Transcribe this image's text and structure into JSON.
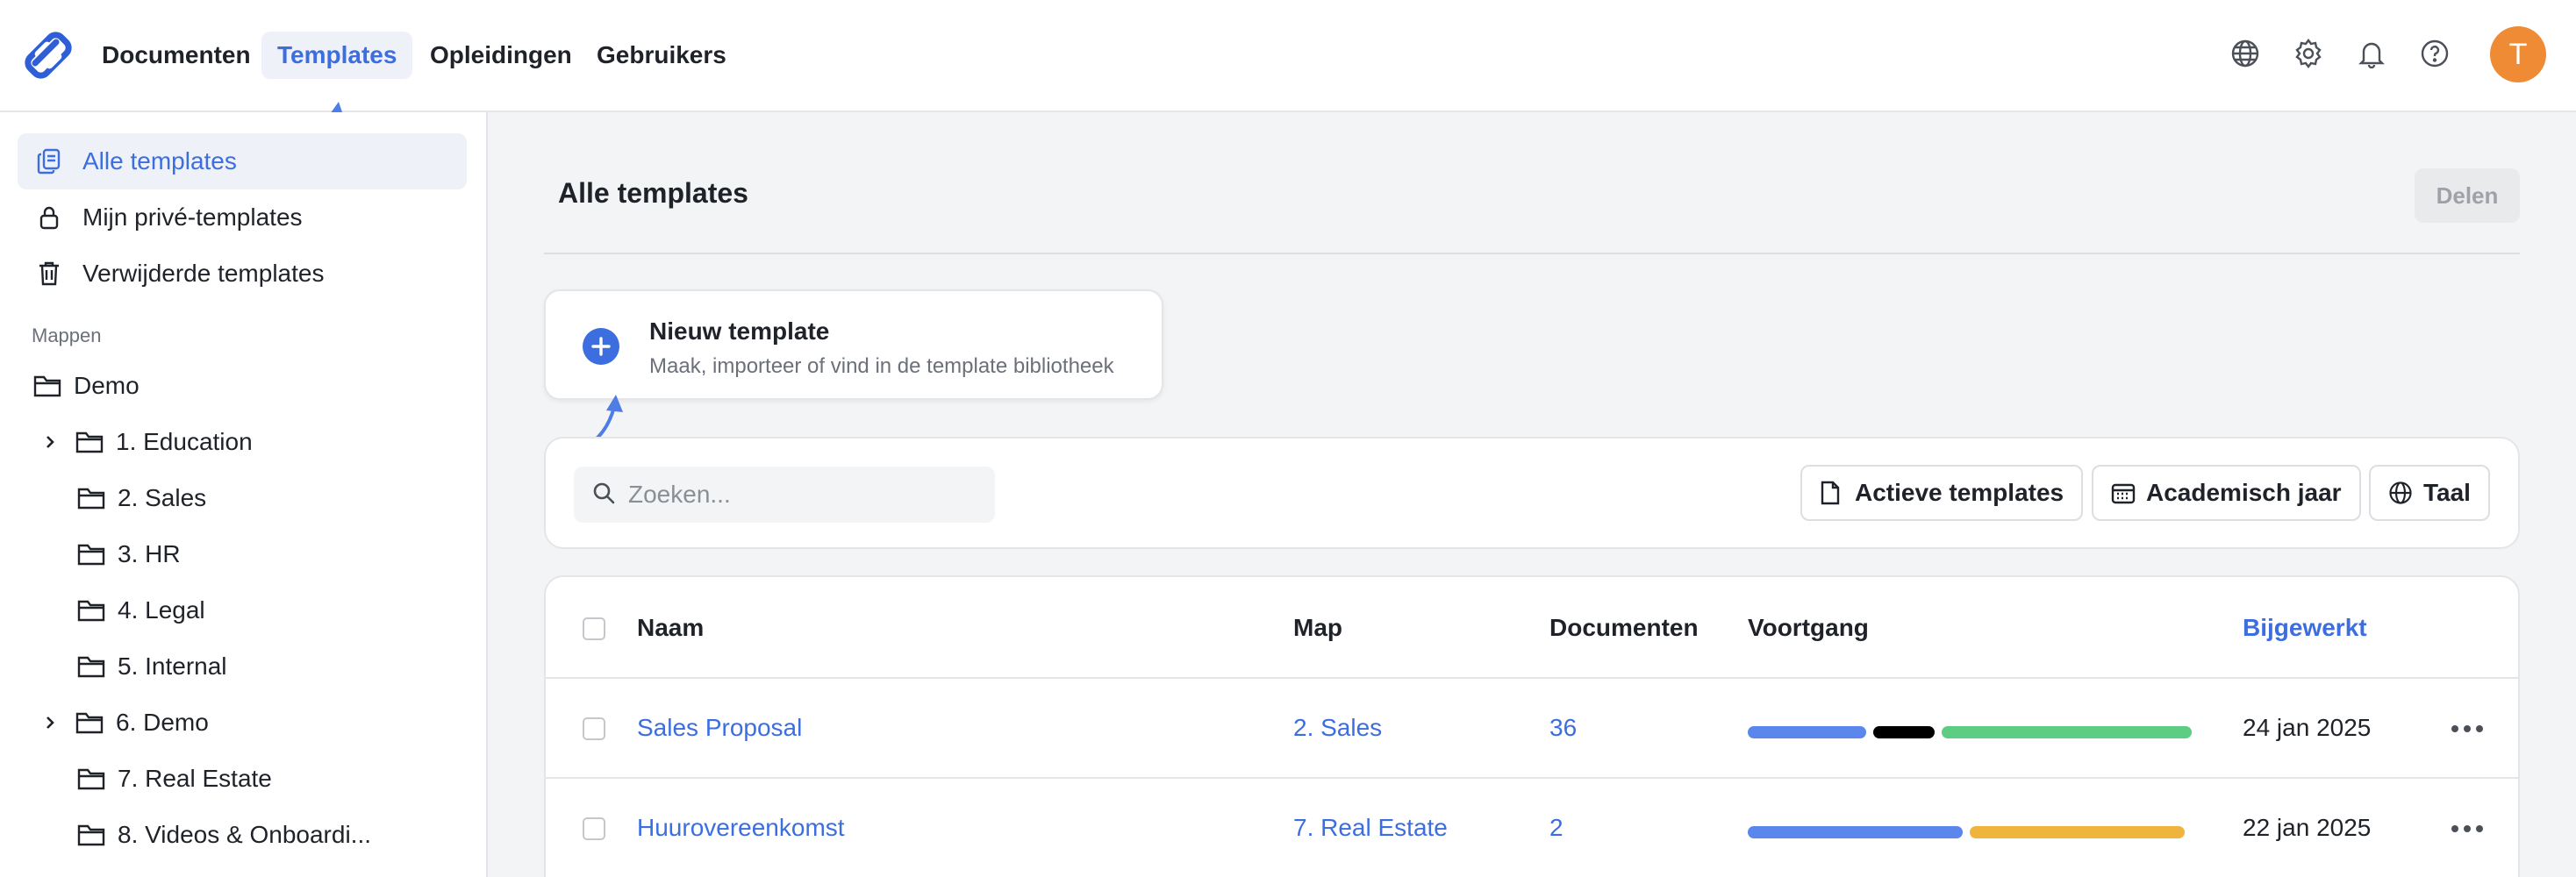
{
  "nav": {
    "items": [
      "Documenten",
      "Templates",
      "Opleidingen",
      "Gebruikers"
    ],
    "active": "Templates",
    "avatar_initial": "T"
  },
  "sidebar": {
    "items": [
      {
        "label": "Alle templates",
        "icon": "copy-icon",
        "active": true
      },
      {
        "label": "Mijn privé-templates",
        "icon": "lock-icon",
        "active": false
      },
      {
        "label": "Verwijderde templates",
        "icon": "trash-icon",
        "active": false
      }
    ],
    "section_label": "Mappen",
    "folders": [
      {
        "label": "Demo",
        "level": 0,
        "expandable": false
      },
      {
        "label": "1. Education",
        "level": 1,
        "expandable": true
      },
      {
        "label": "2. Sales",
        "level": 1,
        "expandable": false
      },
      {
        "label": "3. HR",
        "level": 1,
        "expandable": false
      },
      {
        "label": "4. Legal",
        "level": 1,
        "expandable": false
      },
      {
        "label": "5. Internal",
        "level": 1,
        "expandable": false
      },
      {
        "label": "6. Demo",
        "level": 1,
        "expandable": true
      },
      {
        "label": "7. Real Estate",
        "level": 1,
        "expandable": false
      },
      {
        "label": "8. Videos & Onboardi...",
        "level": 1,
        "expandable": false
      }
    ]
  },
  "main": {
    "title": "Alle templates",
    "share_label": "Delen",
    "new_template": {
      "title": "Nieuw template",
      "subtitle": "Maak, importeer of vind in de template bibliotheek"
    },
    "search_placeholder": "Zoeken...",
    "filters": [
      "Actieve templates",
      "Academisch jaar",
      "Taal"
    ]
  },
  "table": {
    "columns": [
      "Naam",
      "Map",
      "Documenten",
      "Voortgang",
      "Bijgewerkt"
    ],
    "sorted_column": "Bijgewerkt",
    "rows": [
      {
        "name": "Sales Proposal",
        "folder": "2. Sales",
        "documents": "36",
        "updated": "24 jan 2025",
        "progress": [
          {
            "share": 0.27,
            "color": "#5b86ec"
          },
          {
            "share": 0.14,
            "color": "#000000"
          },
          {
            "share": 0.57,
            "color": "#5ccd82"
          }
        ]
      },
      {
        "name": "Huurovereenkomst",
        "folder": "7. Real Estate",
        "documents": "2",
        "updated": "22 jan 2025",
        "progress": [
          {
            "share": 0.49,
            "color": "#5b86ec"
          },
          {
            "share": 0.49,
            "color": "#efb43b"
          }
        ]
      }
    ]
  },
  "colors": {
    "accent": "#3c6ee0",
    "avatar": "#ef8a35"
  }
}
